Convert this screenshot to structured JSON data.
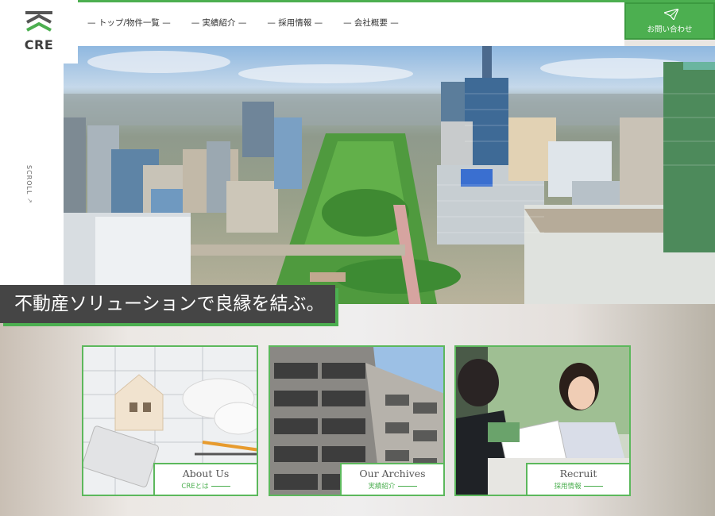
{
  "logo": {
    "text": "CRE"
  },
  "nav": {
    "items": [
      {
        "label": "— トップ/物件一覧 —"
      },
      {
        "label": "— 実績紹介 —"
      },
      {
        "label": "— 採用情報 —"
      },
      {
        "label": "— 会社概要 —"
      }
    ]
  },
  "contact": {
    "label": "お問い合わせ",
    "icon": "paper-plane-icon"
  },
  "hero": {
    "scroll_label": "SCROLL",
    "scroll_arrow": "↘",
    "tagline": "不動産ソリューションで良縁を結ぶ。"
  },
  "cards": [
    {
      "title": "About Us",
      "subtitle": "CREとは"
    },
    {
      "title": "Our Archives",
      "subtitle": "実績紹介"
    },
    {
      "title": "Recruit",
      "subtitle": "採用情報"
    }
  ],
  "colors": {
    "accent": "#4caf50",
    "dark": "#454545"
  }
}
